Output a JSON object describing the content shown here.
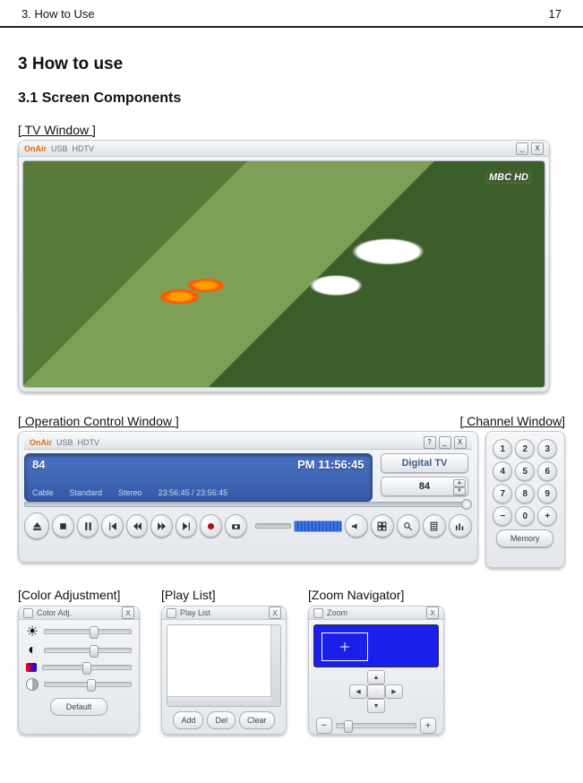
{
  "header": {
    "breadcrumb": "3.    How to Use",
    "page_number": "17"
  },
  "headings": {
    "h1": "3      How to use",
    "h2": "3.1     Screen Components"
  },
  "tv_window": {
    "caption": "[ TV Window ]",
    "brand": "OnAir",
    "product1": "USB",
    "product2": "HDTV",
    "overlay_logo": "MBC HD",
    "min": "_",
    "close": "X"
  },
  "opc": {
    "caption": "[ Operation Control Window ]",
    "brand": "OnAir",
    "product1": "USB",
    "product2": "HDTV",
    "help": "?",
    "min": "_",
    "close": "X",
    "lcd": {
      "channel_number": "84",
      "clock": "PM 11:56:45",
      "source": "Cable",
      "standard": "Standard",
      "audio": "Stereo",
      "elapsed_total": "23:56:45  /  23:56:45"
    },
    "mode_label": "Digital TV",
    "channel_display": "84",
    "playback_button_names": [
      "eject-button",
      "stop-button",
      "pause-button",
      "prev-button",
      "rewind-button",
      "forward-button",
      "next-button",
      "record-button",
      "snapshot-button"
    ],
    "right_icon_names": [
      "mute-icon",
      "fullscreen-icon",
      "search-icon",
      "document-icon",
      "equalizer-icon"
    ]
  },
  "channel_window": {
    "caption": "[ Channel Window]",
    "keys": [
      "1",
      "2",
      "3",
      "4",
      "5",
      "6",
      "7",
      "8",
      "9",
      "−",
      "0",
      "+"
    ],
    "memory_label": "Memory"
  },
  "color_adj": {
    "caption": "[Color Adjustment]",
    "title": "Color Adj.",
    "close": "X",
    "sliders": [
      {
        "name": "brightness-slider",
        "icon": "sun-icon",
        "pos": 0.55
      },
      {
        "name": "contrast-slider",
        "icon": "contrast-icon",
        "pos": 0.55
      },
      {
        "name": "hue-slider",
        "icon": "palette-icon",
        "pos": 0.48
      },
      {
        "name": "saturation-slider",
        "icon": "saturation-icon",
        "pos": 0.52
      }
    ],
    "default_label": "Default"
  },
  "play_list": {
    "caption": "[Play List]",
    "title": "Play List",
    "close": "X",
    "buttons": {
      "add": "Add",
      "del": "Del",
      "clear": "Clear"
    }
  },
  "zoom": {
    "caption": "[Zoom Navigator]",
    "title": "Zoom",
    "close": "X",
    "minus": "−",
    "plus": "+"
  }
}
